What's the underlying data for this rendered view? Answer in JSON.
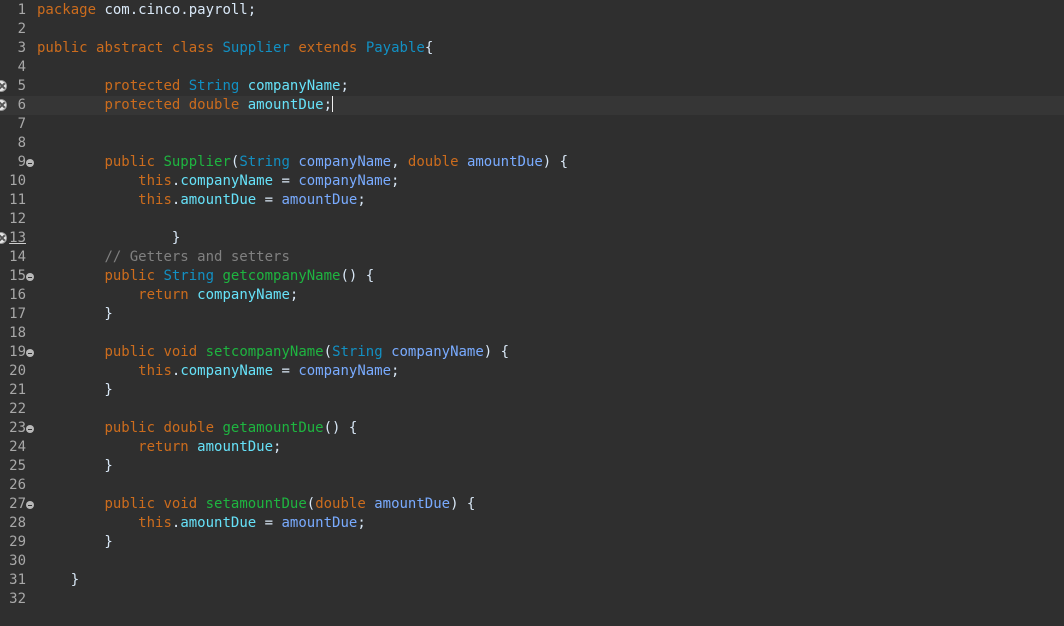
{
  "editor": {
    "language": "java",
    "current_line": 6,
    "colors": {
      "background": "#2f2f2f",
      "current_line": "#363636",
      "keyword": "#cc6c1d",
      "type": "#1290c3",
      "method": "#1eb540",
      "field": "#66e1f8",
      "parameter": "#79abff",
      "text": "#d9e8f7",
      "comment": "#808080",
      "line_number": "#a8a8a8"
    },
    "lines": [
      {
        "num": "1",
        "tokens": [
          {
            "t": "kw",
            "v": "package"
          },
          {
            "t": "tx",
            "v": " com.cinco.payroll;"
          }
        ]
      },
      {
        "num": "2",
        "tokens": []
      },
      {
        "num": "3",
        "tokens": [
          {
            "t": "kw",
            "v": "public"
          },
          {
            "t": "tx",
            "v": " "
          },
          {
            "t": "kw",
            "v": "abstract"
          },
          {
            "t": "tx",
            "v": " "
          },
          {
            "t": "kw",
            "v": "class"
          },
          {
            "t": "tx",
            "v": " "
          },
          {
            "t": "ty",
            "v": "Supplier"
          },
          {
            "t": "tx",
            "v": " "
          },
          {
            "t": "kw",
            "v": "extends"
          },
          {
            "t": "tx",
            "v": " "
          },
          {
            "t": "ty",
            "v": "Payable"
          },
          {
            "t": "tx",
            "v": "{"
          }
        ]
      },
      {
        "num": "4",
        "tokens": []
      },
      {
        "num": "5",
        "marker": "warning",
        "tokens": [
          {
            "t": "tx",
            "v": "        "
          },
          {
            "t": "kw",
            "v": "protected"
          },
          {
            "t": "tx",
            "v": " "
          },
          {
            "t": "ty",
            "v": "String"
          },
          {
            "t": "tx",
            "v": " "
          },
          {
            "t": "va",
            "v": "companyName"
          },
          {
            "t": "tx",
            "v": ";"
          }
        ]
      },
      {
        "num": "6",
        "marker": "warning",
        "tokens": [
          {
            "t": "tx",
            "v": "        "
          },
          {
            "t": "kw",
            "v": "protected"
          },
          {
            "t": "tx",
            "v": " "
          },
          {
            "t": "kw",
            "v": "double"
          },
          {
            "t": "tx",
            "v": " "
          },
          {
            "t": "va",
            "v": "amountDue"
          },
          {
            "t": "tx",
            "v": ";"
          }
        ]
      },
      {
        "num": "7",
        "tokens": []
      },
      {
        "num": "8",
        "tokens": []
      },
      {
        "num": "9",
        "fold": true,
        "tokens": [
          {
            "t": "tx",
            "v": "        "
          },
          {
            "t": "kw",
            "v": "public"
          },
          {
            "t": "tx",
            "v": " "
          },
          {
            "t": "fn",
            "v": "Supplier"
          },
          {
            "t": "tx",
            "v": "("
          },
          {
            "t": "ty",
            "v": "String"
          },
          {
            "t": "tx",
            "v": " "
          },
          {
            "t": "pa",
            "v": "companyName"
          },
          {
            "t": "tx",
            "v": ", "
          },
          {
            "t": "kw",
            "v": "double"
          },
          {
            "t": "tx",
            "v": " "
          },
          {
            "t": "pa",
            "v": "amountDue"
          },
          {
            "t": "tx",
            "v": ") {"
          }
        ]
      },
      {
        "num": "10",
        "tokens": [
          {
            "t": "tx",
            "v": "            "
          },
          {
            "t": "kw",
            "v": "this"
          },
          {
            "t": "tx",
            "v": "."
          },
          {
            "t": "va",
            "v": "companyName"
          },
          {
            "t": "tx",
            "v": " = "
          },
          {
            "t": "pa",
            "v": "companyName"
          },
          {
            "t": "tx",
            "v": ";"
          }
        ]
      },
      {
        "num": "11",
        "tokens": [
          {
            "t": "tx",
            "v": "            "
          },
          {
            "t": "kw",
            "v": "this"
          },
          {
            "t": "tx",
            "v": "."
          },
          {
            "t": "va",
            "v": "amountDue"
          },
          {
            "t": "tx",
            "v": " = "
          },
          {
            "t": "pa",
            "v": "amountDue"
          },
          {
            "t": "tx",
            "v": ";"
          }
        ]
      },
      {
        "num": "12",
        "tokens": []
      },
      {
        "num": "13",
        "marker": "warning",
        "underlined": true,
        "tokens": [
          {
            "t": "tx",
            "v": "                }"
          }
        ]
      },
      {
        "num": "14",
        "tokens": [
          {
            "t": "tx",
            "v": "        "
          },
          {
            "t": "cm",
            "v": "// Getters and setters"
          }
        ]
      },
      {
        "num": "15",
        "fold": true,
        "tokens": [
          {
            "t": "tx",
            "v": "        "
          },
          {
            "t": "kw",
            "v": "public"
          },
          {
            "t": "tx",
            "v": " "
          },
          {
            "t": "ty",
            "v": "String"
          },
          {
            "t": "tx",
            "v": " "
          },
          {
            "t": "fn",
            "v": "getcompanyName"
          },
          {
            "t": "tx",
            "v": "() {"
          }
        ]
      },
      {
        "num": "16",
        "tokens": [
          {
            "t": "tx",
            "v": "            "
          },
          {
            "t": "kw",
            "v": "return"
          },
          {
            "t": "tx",
            "v": " "
          },
          {
            "t": "va",
            "v": "companyName"
          },
          {
            "t": "tx",
            "v": ";"
          }
        ]
      },
      {
        "num": "17",
        "tokens": [
          {
            "t": "tx",
            "v": "        }"
          }
        ]
      },
      {
        "num": "18",
        "tokens": []
      },
      {
        "num": "19",
        "fold": true,
        "tokens": [
          {
            "t": "tx",
            "v": "        "
          },
          {
            "t": "kw",
            "v": "public"
          },
          {
            "t": "tx",
            "v": " "
          },
          {
            "t": "kw",
            "v": "void"
          },
          {
            "t": "tx",
            "v": " "
          },
          {
            "t": "fn",
            "v": "setcompanyName"
          },
          {
            "t": "tx",
            "v": "("
          },
          {
            "t": "ty",
            "v": "String"
          },
          {
            "t": "tx",
            "v": " "
          },
          {
            "t": "pa",
            "v": "companyName"
          },
          {
            "t": "tx",
            "v": ") {"
          }
        ]
      },
      {
        "num": "20",
        "tokens": [
          {
            "t": "tx",
            "v": "            "
          },
          {
            "t": "kw",
            "v": "this"
          },
          {
            "t": "tx",
            "v": "."
          },
          {
            "t": "va",
            "v": "companyName"
          },
          {
            "t": "tx",
            "v": " = "
          },
          {
            "t": "pa",
            "v": "companyName"
          },
          {
            "t": "tx",
            "v": ";"
          }
        ]
      },
      {
        "num": "21",
        "tokens": [
          {
            "t": "tx",
            "v": "        }"
          }
        ]
      },
      {
        "num": "22",
        "tokens": []
      },
      {
        "num": "23",
        "fold": true,
        "tokens": [
          {
            "t": "tx",
            "v": "        "
          },
          {
            "t": "kw",
            "v": "public"
          },
          {
            "t": "tx",
            "v": " "
          },
          {
            "t": "kw",
            "v": "double"
          },
          {
            "t": "tx",
            "v": " "
          },
          {
            "t": "fn",
            "v": "getamountDue"
          },
          {
            "t": "tx",
            "v": "() {"
          }
        ]
      },
      {
        "num": "24",
        "tokens": [
          {
            "t": "tx",
            "v": "            "
          },
          {
            "t": "kw",
            "v": "return"
          },
          {
            "t": "tx",
            "v": " "
          },
          {
            "t": "va",
            "v": "amountDue"
          },
          {
            "t": "tx",
            "v": ";"
          }
        ]
      },
      {
        "num": "25",
        "tokens": [
          {
            "t": "tx",
            "v": "        }"
          }
        ]
      },
      {
        "num": "26",
        "tokens": []
      },
      {
        "num": "27",
        "fold": true,
        "tokens": [
          {
            "t": "tx",
            "v": "        "
          },
          {
            "t": "kw",
            "v": "public"
          },
          {
            "t": "tx",
            "v": " "
          },
          {
            "t": "kw",
            "v": "void"
          },
          {
            "t": "tx",
            "v": " "
          },
          {
            "t": "fn",
            "v": "setamountDue"
          },
          {
            "t": "tx",
            "v": "("
          },
          {
            "t": "kw",
            "v": "double"
          },
          {
            "t": "tx",
            "v": " "
          },
          {
            "t": "pa",
            "v": "amountDue"
          },
          {
            "t": "tx",
            "v": ") {"
          }
        ]
      },
      {
        "num": "28",
        "tokens": [
          {
            "t": "tx",
            "v": "            "
          },
          {
            "t": "kw",
            "v": "this"
          },
          {
            "t": "tx",
            "v": "."
          },
          {
            "t": "va",
            "v": "amountDue"
          },
          {
            "t": "tx",
            "v": " = "
          },
          {
            "t": "pa",
            "v": "amountDue"
          },
          {
            "t": "tx",
            "v": ";"
          }
        ]
      },
      {
        "num": "29",
        "tokens": [
          {
            "t": "tx",
            "v": "        }"
          }
        ]
      },
      {
        "num": "30",
        "tokens": []
      },
      {
        "num": "31",
        "tokens": [
          {
            "t": "tx",
            "v": "    }"
          }
        ]
      },
      {
        "num": "32",
        "tokens": []
      }
    ]
  }
}
